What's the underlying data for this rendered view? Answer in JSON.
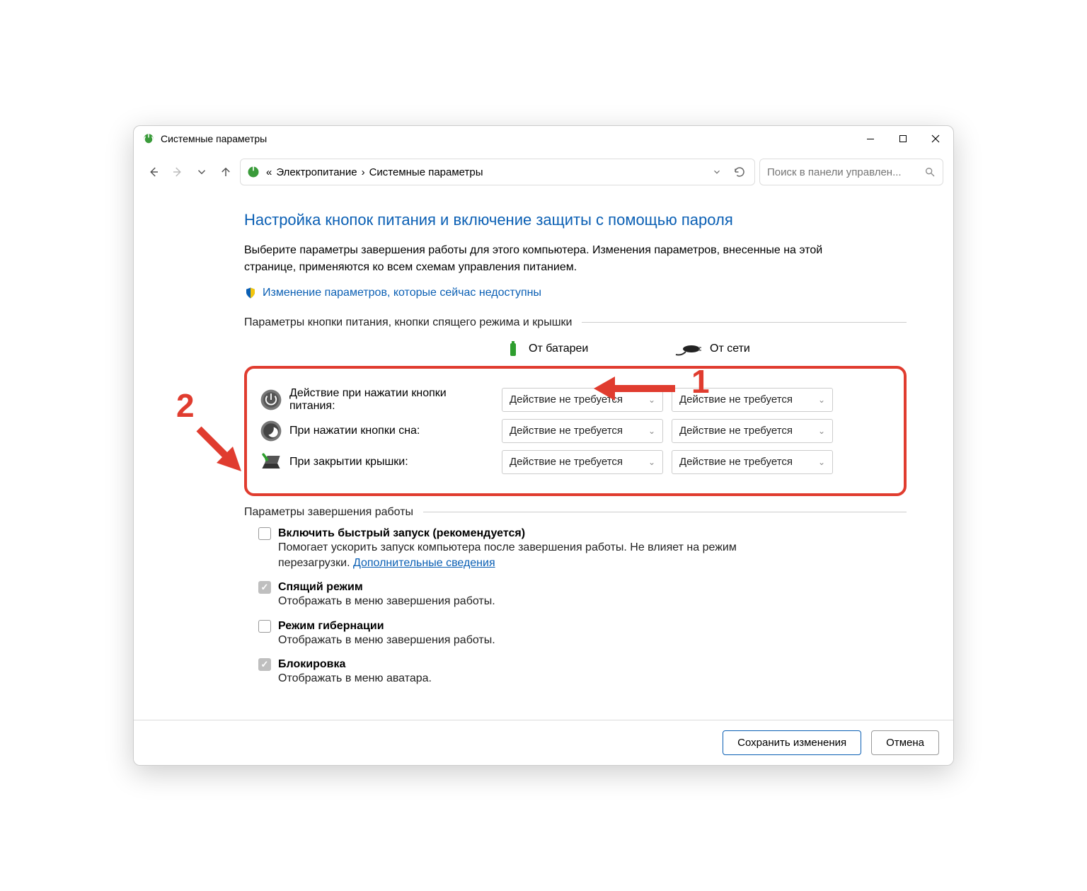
{
  "window": {
    "title": "Системные параметры"
  },
  "nav": {
    "breadcrumb_prefix": "«",
    "crumb1": "Электропитание",
    "crumb_sep": "›",
    "crumb2": "Системные параметры"
  },
  "search": {
    "placeholder": "Поиск в панели управлен..."
  },
  "heading": "Настройка кнопок питания и включение защиты с помощью пароля",
  "intro": "Выберите параметры завершения работы для этого компьютера. Изменения параметров, внесенные на этой странице, применяются ко всем схемам управления питанием.",
  "unlock_link": "Изменение параметров, которые сейчас недоступны",
  "section_buttons": "Параметры кнопки питания, кнопки спящего режима и крышки",
  "col_battery": "От батареи",
  "col_ac": "От сети",
  "rows": [
    {
      "label": "Действие при нажатии кнопки питания:",
      "battery": "Действие не требуется",
      "ac": "Действие не требуется"
    },
    {
      "label": "При нажатии кнопки сна:",
      "battery": "Действие не требуется",
      "ac": "Действие не требуется"
    },
    {
      "label": "При закрытии крышки:",
      "battery": "Действие не требуется",
      "ac": "Действие не требуется"
    }
  ],
  "section_shutdown": "Параметры завершения работы",
  "opts": {
    "fastboot": {
      "title": "Включить быстрый запуск (рекомендуется)",
      "desc": "Помогает ускорить запуск компьютера после завершения работы. Не влияет на режим перезагрузки. ",
      "link": "Дополнительные сведения",
      "checked": false
    },
    "sleep": {
      "title": "Спящий режим",
      "desc": "Отображать в меню завершения работы.",
      "checked": true
    },
    "hibernate": {
      "title": "Режим гибернации",
      "desc": "Отображать в меню завершения работы.",
      "checked": false
    },
    "lock": {
      "title": "Блокировка",
      "desc": "Отображать в меню аватара.",
      "checked": true
    }
  },
  "buttons": {
    "save": "Сохранить изменения",
    "cancel": "Отмена"
  },
  "annotations": {
    "one": "1",
    "two": "2"
  }
}
